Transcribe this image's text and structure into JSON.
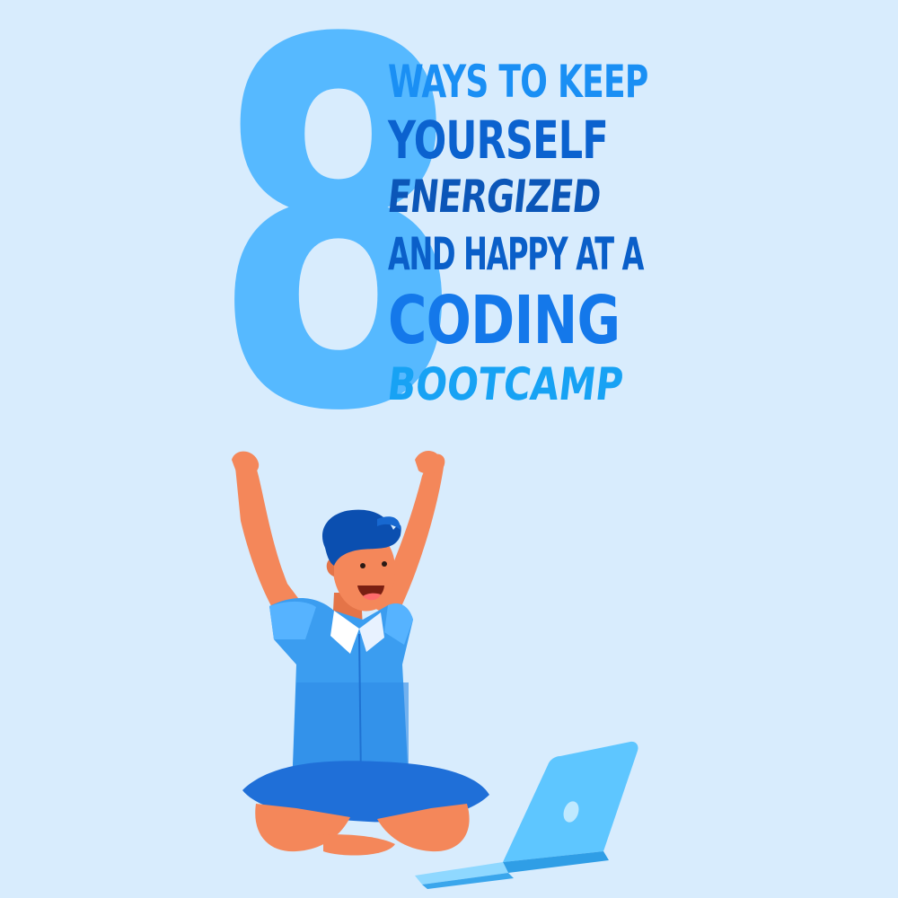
{
  "poster": {
    "number": "8",
    "title_lines": [
      "WAYS TO KEEP",
      "YOURSELF",
      "ENERGIZED",
      "AND HAPPY AT A",
      "CODING",
      "BOOTCAMP"
    ]
  },
  "colors": {
    "background": "#d8ecfd",
    "number": "#56b9ff",
    "shirt": "#3b9df0",
    "shorts": "#1f6fd8",
    "skin": "#f4875a",
    "hair": "#0b4fb0",
    "laptop": "#5ec6ff"
  },
  "illustration": {
    "subject": "happy-coder-with-laptop"
  }
}
